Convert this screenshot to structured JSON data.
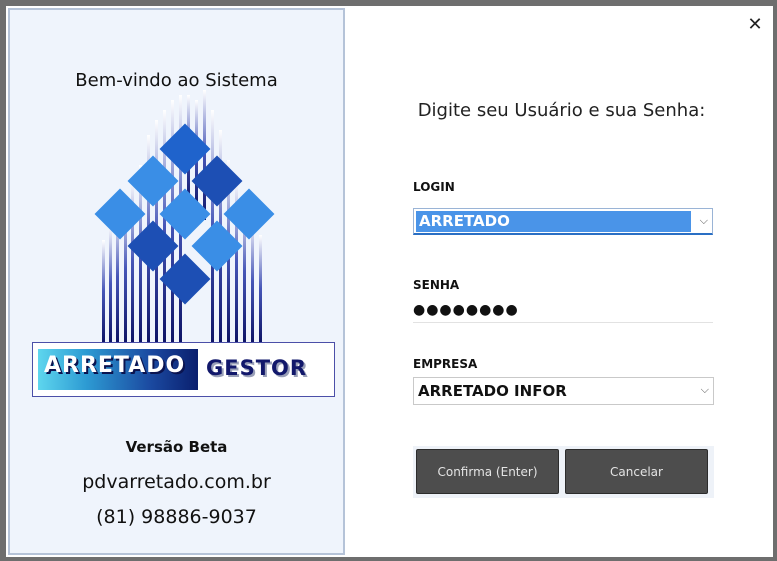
{
  "left_panel": {
    "welcome": "Bem-vindo ao Sistema",
    "logo": {
      "word1": "ARRETADO",
      "word2": "GESTOR"
    },
    "version": "Versão Beta",
    "website": "pdvarretado.com.br",
    "phone": "(81) 98886-9037"
  },
  "window": {
    "close_icon": "close-icon"
  },
  "form": {
    "prompt": "Digite seu Usuário e sua Senha:",
    "login": {
      "label": "LOGIN",
      "value": "ARRETADO"
    },
    "senha": {
      "label": "SENHA",
      "value": "●●●●●●●●"
    },
    "empresa": {
      "label": "EMPRESA",
      "value": "ARRETADO INFOR"
    },
    "confirm_label": "Confirma (Enter)",
    "cancel_label": "Cancelar"
  },
  "colors": {
    "accent": "#4a94e8",
    "logo_dark": "#12186b",
    "button_bg": "#4d4d4d"
  }
}
